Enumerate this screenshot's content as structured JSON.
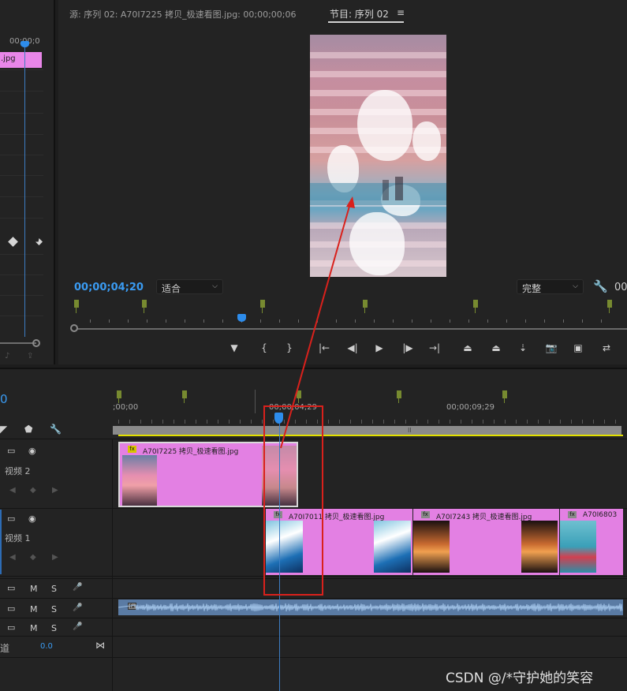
{
  "effect_controls": {
    "timecode": "00;00;0",
    "clip_label": ".jpg"
  },
  "monitor": {
    "source_tab": "源: 序列 02: A70I7225 拷贝_极速看图.jpg: 00;00;00;06",
    "program_tab": "节目: 序列 02",
    "menu_glyph": "≡",
    "current_timecode": "00;00;04;20",
    "fit_value": "适合",
    "quality_value": "完整",
    "right_timecode": "00"
  },
  "transport": {
    "buttons": [
      {
        "name": "add-marker-button",
        "glyph": "▼"
      },
      {
        "name": "mark-in-button",
        "glyph": "{"
      },
      {
        "name": "mark-out-button",
        "glyph": "}"
      },
      {
        "name": "go-to-in-button",
        "glyph": "|←"
      },
      {
        "name": "step-back-button",
        "glyph": "◀|"
      },
      {
        "name": "play-button",
        "glyph": "▶"
      },
      {
        "name": "step-forward-button",
        "glyph": "|▶"
      },
      {
        "name": "go-to-out-button",
        "glyph": "→|"
      },
      {
        "name": "lift-button",
        "glyph": "⏏"
      },
      {
        "name": "extract-button",
        "glyph": "⏏"
      },
      {
        "name": "insert-button",
        "glyph": "⇣"
      },
      {
        "name": "export-frame-button",
        "glyph": "📷"
      },
      {
        "name": "compare-button",
        "glyph": "▣"
      },
      {
        "name": "toggle-proxies-button",
        "glyph": "⇄"
      }
    ]
  },
  "timeline": {
    "current_timecode": "0",
    "ruler_labels": [
      ";00;00",
      "00;00;04;29",
      "00;00;09;29"
    ],
    "work_bar_mid": "II",
    "tracks": {
      "v2": {
        "label": "视频 2"
      },
      "v1": {
        "label": "视频 1"
      },
      "audio": [
        {
          "m": "M",
          "s": "S"
        },
        {
          "m": "M",
          "s": "S"
        },
        {
          "m": "M",
          "s": "S"
        }
      ],
      "master": {
        "label": "道",
        "value": "0.0"
      }
    },
    "clips": {
      "v2": [
        {
          "name": "A70I7225 拷贝_极速看图.jpg",
          "badge": "fx"
        }
      ],
      "v1": [
        {
          "name": "A70I7011 拷贝_极速看图.jpg",
          "badge": "fx"
        },
        {
          "name": "A70I7243 拷贝_极速看图.jpg",
          "badge": "fx"
        },
        {
          "name": "A70I6803",
          "badge": "fx"
        }
      ],
      "audio": [
        {
          "badge": "fx"
        }
      ]
    }
  },
  "colors": {
    "accent_blue": "#3a9bf2",
    "clip_pink": "#e380e3",
    "marker_olive": "#778a30",
    "annotation_red": "#d9211c",
    "render_yellow": "#e2e000"
  },
  "watermark": "CSDN @/*守护她的笑容"
}
